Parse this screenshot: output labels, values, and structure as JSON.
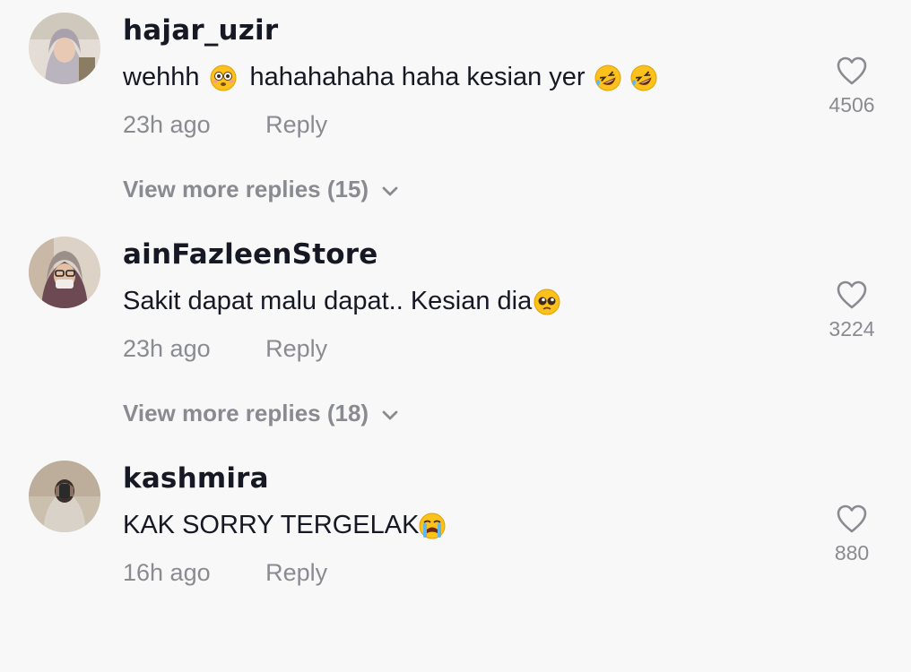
{
  "comments": [
    {
      "username": "hajar_uzir",
      "text_parts": [
        "wehhh",
        "hahahahaha haha kesian yer"
      ],
      "emojis": [
        "flushed-face",
        "rofl-face",
        "rofl-face"
      ],
      "time": "23h ago",
      "reply_label": "Reply",
      "likes": "4506",
      "view_more": "View more replies (15)"
    },
    {
      "username": "ainFazleenStore",
      "text_parts": [
        "Sakit dapat malu dapat.. Kesian dia"
      ],
      "emojis": [
        "pleading-face"
      ],
      "time": "23h ago",
      "reply_label": "Reply",
      "likes": "3224",
      "view_more": "View more replies (18)"
    },
    {
      "username": "kashmira",
      "text_parts": [
        "KAK SORRY TERGELAK"
      ],
      "emojis": [
        "crying-face"
      ],
      "time": "16h ago",
      "reply_label": "Reply",
      "likes": "880"
    }
  ],
  "colors": {
    "background": "#f8f8f8",
    "username": "#161823",
    "secondary": "#8a8b91"
  }
}
